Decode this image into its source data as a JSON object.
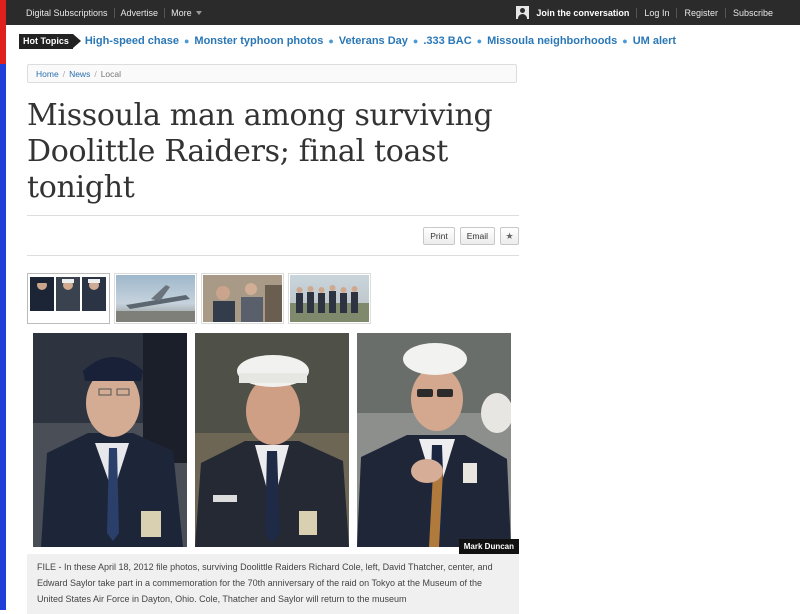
{
  "topbar": {
    "left": [
      "Digital Subscriptions",
      "Advertise",
      "More"
    ],
    "join": "Join the conversation",
    "right": [
      "Log In",
      "Register",
      "Subscribe"
    ]
  },
  "hot_topics": {
    "label": "Hot Topics",
    "links": [
      "High-speed chase",
      "Monster typhoon photos",
      "Veterans Day",
      ".333 BAC",
      "Missoula neighborhoods",
      "UM alert"
    ]
  },
  "breadcrumb": {
    "home": "Home",
    "news": "News",
    "current": "Local"
  },
  "article": {
    "title": "Missoula man among surviving Doolittle Raiders; final toast tonight",
    "tools": {
      "print": "Print",
      "email": "Email",
      "star": "★"
    },
    "photo_credit": "Mark Duncan",
    "caption": "FILE - In these April 18, 2012 file photos, surviving Doolittle Raiders Richard Cole, left, David Thatcher, center, and Edward Saylor take part in a commemoration for the 70th anniversary of the raid on Tokyo at the Museum of the United States Air Force in Dayton, Ohio. Cole, Thatcher and Saylor will return to the museum"
  },
  "colors": {
    "link": "#2a77b6",
    "topbar": "#2b2b2b",
    "stripe_red": "#e0201c",
    "stripe_blue": "#1f3fd8"
  }
}
